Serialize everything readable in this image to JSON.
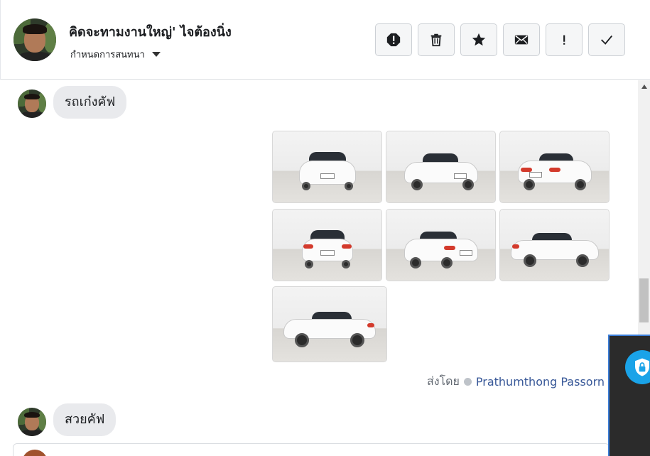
{
  "header": {
    "title": "คิดจะทามงานใหญ่' ไจต้องนิ่ง",
    "subtitle": "กำหนดการสนทนา",
    "toolbar": [
      {
        "name": "report-button",
        "icon": "exclamation-octagon-icon"
      },
      {
        "name": "delete-button",
        "icon": "trash-icon"
      },
      {
        "name": "star-button",
        "icon": "star-icon"
      },
      {
        "name": "mark-unread-button",
        "icon": "envelope-icon"
      },
      {
        "name": "important-button",
        "icon": "exclamation-icon"
      },
      {
        "name": "done-button",
        "icon": "check-icon"
      }
    ]
  },
  "messages": [
    {
      "text": "รถเก๋งคัฟ"
    },
    {
      "text": "สวยคัฟ"
    }
  ],
  "attachments": {
    "count": 7,
    "views": [
      "front",
      "front-angle",
      "rear-angle",
      "rear",
      "rear-left",
      "side-right",
      "side-left"
    ]
  },
  "sent_by": {
    "prefix": "ส่งโดย",
    "name": "Prathumthong Passorn",
    "help": "?"
  },
  "colors": {
    "link": "#385898",
    "bubble": "#e9eaed",
    "overlay": "#2b2b2b",
    "shield": "#1aa3e8"
  }
}
